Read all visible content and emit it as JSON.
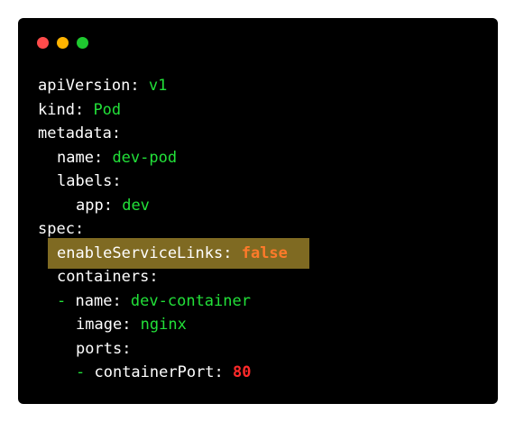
{
  "window": {
    "dots": [
      {
        "name": "close",
        "color": "#ff4b4b"
      },
      {
        "name": "minimize",
        "color": "#ffb400"
      },
      {
        "name": "maximize",
        "color": "#1ec92f"
      }
    ]
  },
  "code": {
    "lines": [
      {
        "key": "apiVersion",
        "sep": ": ",
        "value": "v1"
      },
      {
        "key": "kind",
        "sep": ": ",
        "value": "Pod"
      },
      {
        "key": "metadata",
        "sep": ":"
      },
      {
        "key": "name",
        "sep": ": ",
        "value": "dev-pod"
      },
      {
        "key": "labels",
        "sep": ":"
      },
      {
        "key": "app",
        "sep": ": ",
        "value": "dev"
      },
      {
        "key": "spec",
        "sep": ":"
      },
      {
        "key": "enableServiceLinks",
        "sep": ": ",
        "value": "false"
      },
      {
        "key": "containers",
        "sep": ":"
      },
      {
        "dash": "- ",
        "key": "name",
        "sep": ": ",
        "value": "dev-container"
      },
      {
        "key": "image",
        "sep": ": ",
        "value": "nginx"
      },
      {
        "key": "ports",
        "sep": ":"
      },
      {
        "dash": "- ",
        "key": "containerPort",
        "sep": ": ",
        "value": "80"
      }
    ]
  },
  "colors": {
    "background": "#000000",
    "string": "#22e039",
    "number": "#ff2a2a",
    "boolean": "#ff7a2a",
    "highlight": "#7f6a22"
  }
}
